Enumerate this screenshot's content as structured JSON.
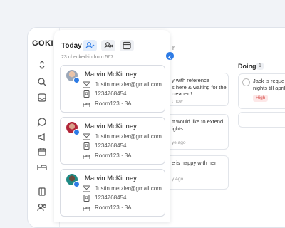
{
  "app": {
    "logo": "GOKI"
  },
  "panel": {
    "title": "Today",
    "subtitle": "23 checked-in from 567",
    "cards": [
      {
        "name": "Marvin McKinney",
        "email": "Justin.metzler@gmail.com",
        "phone": "1234768454",
        "room": "Room123",
        "bed": "3A"
      },
      {
        "name": "Marvin McKinney",
        "email": "Justin.metzler@gmail.com",
        "phone": "1234768454",
        "room": "Room123",
        "bed": "3A"
      },
      {
        "name": "Marvin McKinney",
        "email": "Justin.metzler@gmail.com",
        "phone": "1234768454",
        "room": "Room123",
        "bed": "3A"
      }
    ]
  },
  "board": {
    "search_placeholder": "h",
    "todo_cards": [
      {
        "line1": "y with reference",
        "line2": "s here & waiting for the",
        "line3": "cleaned!",
        "meta": "t now"
      },
      {
        "line1": "tt would like to extend",
        "line2": "ights.",
        "meta": "ye ago"
      },
      {
        "line1": "e is happy with her",
        "meta": "y Ago"
      }
    ],
    "doing": {
      "title": "Doing",
      "count": "1",
      "card": {
        "line1": "Jack is reque",
        "line2": "nights till april",
        "priority": "High"
      }
    }
  },
  "colors": {
    "accent": "#2d7be5",
    "high": "#d9534f"
  }
}
